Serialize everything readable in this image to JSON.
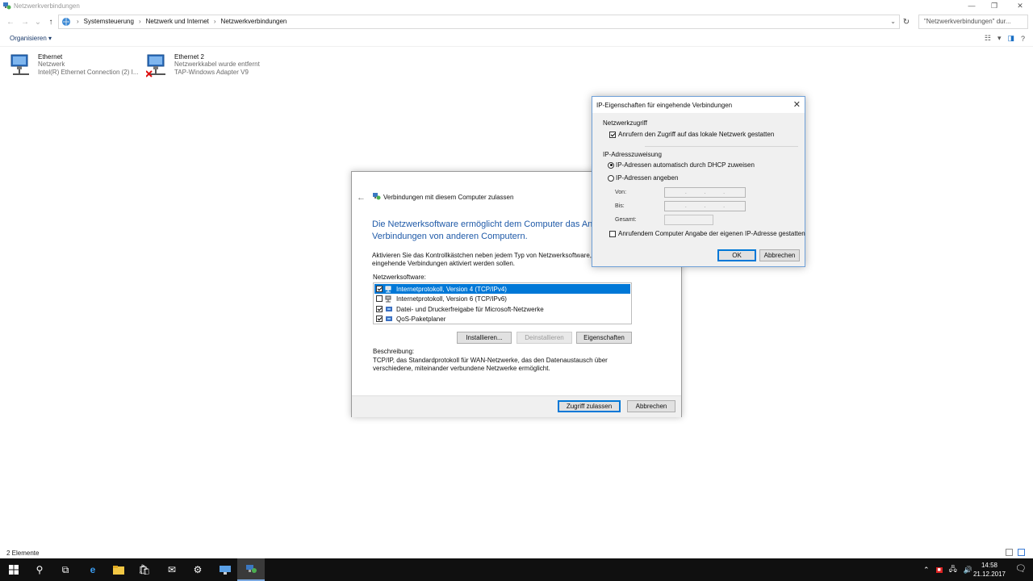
{
  "window": {
    "title": "Netzwerkverbindungen",
    "controls": [
      "—",
      "❐",
      "✕"
    ]
  },
  "address": {
    "crumbs": [
      "Systemsteuerung",
      "Netzwerk und Internet",
      "Netzwerkverbindungen"
    ],
    "search_placeholder": "\"Netzwerkverbindungen\" dur..."
  },
  "commandbar": {
    "organize_label": "Organisieren ▾"
  },
  "connections": [
    {
      "name": "Ethernet",
      "status": "Netzwerk",
      "adapter": "Intel(R) Ethernet Connection (2) I...",
      "disconnected": false
    },
    {
      "name": "Ethernet 2",
      "status": "Netzwerkkabel wurde entfernt",
      "adapter": "TAP-Windows Adapter V9",
      "disconnected": true
    }
  ],
  "statusbar": {
    "count": "2 Elemente"
  },
  "taskbar": {
    "time": "14:58",
    "date": "21.12.2017"
  },
  "wizard": {
    "title": "Verbindungen mit diesem Computer zulassen",
    "heading_line1": "Die Netzwerksoftware ermöglicht dem Computer das Anne",
    "heading_line2": "Verbindungen von anderen Computern.",
    "intro_line1": "Aktivieren Sie das Kontrollkästchen neben jedem Typ von Netzwerksoftware,",
    "intro_line2": "eingehende Verbindungen aktiviert werden sollen.",
    "list_label": "Netzwerksoftware:",
    "items": [
      {
        "label": "Internetprotokoll, Version 4 (TCP/IPv4)",
        "checked": true,
        "selected": true
      },
      {
        "label": "Internetprotokoll, Version 6 (TCP/IPv6)",
        "checked": false,
        "selected": false
      },
      {
        "label": "Datei- und Druckerfreigabe für Microsoft-Netzwerke",
        "checked": true,
        "selected": false
      },
      {
        "label": "QoS-Paketplaner",
        "checked": true,
        "selected": false
      }
    ],
    "install_button": "Installieren...",
    "uninstall_button": "Deinstallieren",
    "properties_button": "Eigenschaften",
    "desc_label": "Beschreibung:",
    "desc_line1": "TCP/IP, das Standardprotokoll für WAN-Netzwerke, das den Datenaustausch über",
    "desc_line2": "verschiedene, miteinander verbundene Netzwerke ermöglicht.",
    "allow_button": "Zugriff zulassen",
    "cancel_button": "Abbrechen"
  },
  "ip_dialog": {
    "title": "IP-Eigenschaften für eingehende Verbindungen",
    "network_access_group": "Netzwerkzugriff",
    "allow_lan_label": "Anrufern den Zugriff auf das lokale Netzwerk gestatten",
    "allow_lan_checked": true,
    "ip_assignment_group": "IP-Adresszuweisung",
    "dhcp_label": "IP-Adressen automatisch durch DHCP zuweisen",
    "specify_label": "IP-Adressen angeben",
    "selected_option": "dhcp",
    "from_label": "Von:",
    "to_label": "Bis:",
    "total_label": "Gesamt:",
    "caller_ip_label": "Anrufendem Computer Angabe der eigenen IP-Adresse gestatten",
    "caller_ip_checked": false,
    "ok_button": "OK",
    "cancel_button": "Abbrechen"
  }
}
